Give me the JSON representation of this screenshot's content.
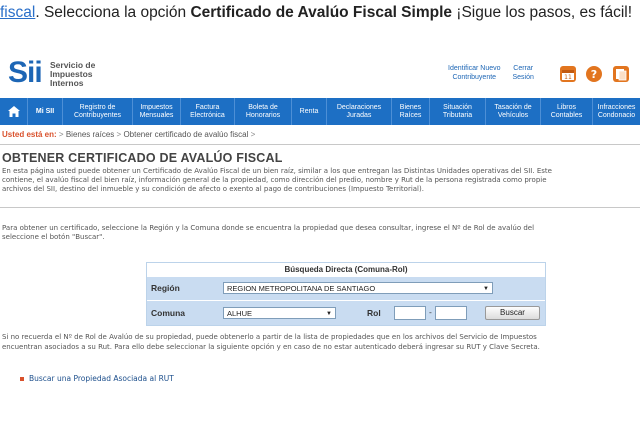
{
  "caption": {
    "link": "fiscal",
    "before": ". Selecciona la opción ",
    "bold": "Certificado de Avalúo Fiscal Simple",
    "after": " ¡Sigue los pasos, es fácil!"
  },
  "header": {
    "logo_mark": "Sii",
    "logo_text": [
      "Servicio de",
      "Impuestos",
      "Internos"
    ],
    "link_identify": [
      "Identificar Nuevo",
      "Contribuyente"
    ],
    "link_logout": [
      "Cerrar",
      "Sesión"
    ]
  },
  "nav": {
    "home": "⌂",
    "items": [
      [
        "Mi SII"
      ],
      [
        "Registro de",
        "Contribuyentes"
      ],
      [
        "Impuestos",
        "Mensuales"
      ],
      [
        "Factura",
        "Electrónica"
      ],
      [
        "Boleta de",
        "Honorarios"
      ],
      [
        "Renta"
      ],
      [
        "Declaraciones",
        "Juradas"
      ],
      [
        "Bienes",
        "Raíces"
      ],
      [
        "Situación",
        "Tributaria"
      ],
      [
        "Tasación de",
        "Vehículos"
      ],
      [
        "Libros",
        "Contables"
      ],
      [
        "Infracciones",
        "Condonacio"
      ]
    ]
  },
  "breadcrumb": {
    "here": "Usted está en:",
    "items": [
      "Bienes raíces",
      "Obtener certificado de avalúo fiscal"
    ],
    "sep": ">"
  },
  "page": {
    "title": "OBTENER CERTIFICADO DE AVALÚO FISCAL",
    "intro": [
      "En esta página usted puede obtener un Certificado de Avalúo Fiscal de un bien raíz, similar a los que entregan las Distintas Unidades operativas del SII. Este",
      "contiene, el avalúo fiscal del bien raíz, información general de la propiedad, como dirección del predio, nombre y Rut de la persona registrada como propie",
      "archivos del SII, destino del inmueble y su condición de afecto o exento al pago de contribuciones (Impuesto Territorial)."
    ],
    "instructions": [
      "Para obtener un certificado, seleccione la Región y la Comuna donde se encuentra la propiedad que desea consultar, ingrese el Nº de Rol de avalúo del",
      "seleccione el botón \"Buscar\"."
    ],
    "note": [
      "Si no recuerda el Nº de Rol de Avalúo de su propiedad, puede obtenerlo a partir de la lista de propiedades que en los archivos del Servicio de Impuestos",
      "encuentran asociados a su Rut. Para ello debe seleccionar la siguiente opción y en caso de no estar autenticado deberá ingresar su RUT y Clave Secreta."
    ],
    "link_rut": "Buscar una Propiedad Asociada al RUT"
  },
  "form": {
    "title": "Búsqueda Directa (Comuna-Rol)",
    "region_label": "Región",
    "region_value": "REGION METROPOLITANA DE SANTIAGO",
    "comuna_label": "Comuna",
    "comuna_value": "ALHUE",
    "rol_label": "Rol",
    "rol_dash": "-",
    "search_button": "Buscar",
    "arrow": "▼"
  },
  "colors": {
    "nav_bg": "#1d6fc4",
    "brand_blue": "#1d66b5",
    "breadcrumb_here": "#d9512c",
    "form_row_bg": "#c9dcf1"
  }
}
